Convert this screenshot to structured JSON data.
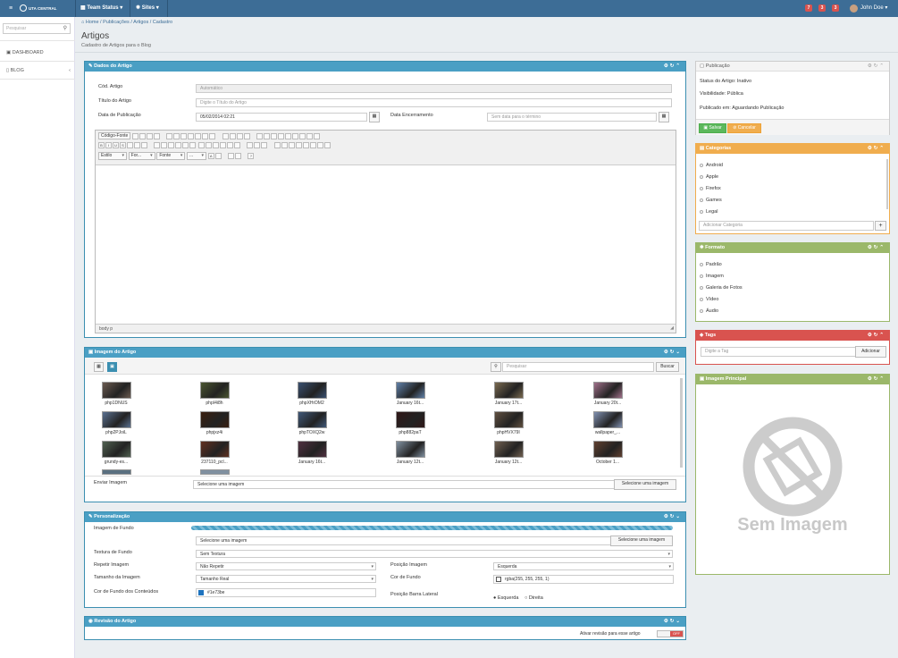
{
  "topbar": {
    "brand": "UTA CENTRAL",
    "menu1": "Team Status",
    "menu2": "Sites",
    "badges": [
      "7",
      "3",
      "3"
    ],
    "user": "John Doe"
  },
  "sidebar": {
    "search_placeholder": "Pesquisar",
    "items": [
      {
        "label": "DASHBOARD"
      },
      {
        "label": "BLOG"
      }
    ]
  },
  "breadcrumb": {
    "home": "Home",
    "b1": "Publicações",
    "b2": "Artigos",
    "b3": "Cadastro"
  },
  "page": {
    "title": "Artigos",
    "subtitle": "Cadastro de Artigos para o Blog"
  },
  "dados": {
    "title": "Dados do Artigo",
    "cod_label": "Cód. Artigo",
    "cod_value": "Automático",
    "titulo_label": "Título do Artigo",
    "titulo_placeholder": "Digite o Título do Artigo",
    "datapub_label": "Data de Publicação",
    "datapub_value": "05/02/2014 02:21",
    "dataenc_label": "Data Encerramento",
    "dataenc_placeholder": "Sem data para o término",
    "editor_source": "Código-Fonte",
    "editor_estilo": "Estilo",
    "editor_formatacao": "For...",
    "editor_fonte": "Fonte",
    "editor_tamanho": "...",
    "editor_status": "body p"
  },
  "imagem": {
    "title": "Imagem do Artigo",
    "search_placeholder": "Pesquisar",
    "search_btn": "Buscar",
    "enviar_label": "Enviar Imagem",
    "enviar_value": "Selecione uma imagem",
    "enviar_btn": "Selecione uma imagem",
    "thumbs": [
      {
        "caption": "php1DNUS",
        "color": "#6a5a50"
      },
      {
        "caption": "phpI4i8h",
        "color": "#4a5530"
      },
      {
        "caption": "phpXHrDM2",
        "color": "#3a5070"
      },
      {
        "caption": "January 16t...",
        "color": "#6080a8"
      },
      {
        "caption": "January 17t...",
        "color": "#7a6a50"
      },
      {
        "caption": "January 20t...",
        "color": "#a0708a"
      },
      {
        "caption": "php2PJoiL",
        "color": "#5a7090"
      },
      {
        "caption": "phpjxz4i",
        "color": "#3a2010"
      },
      {
        "caption": "phpTOXQ2w",
        "color": "#405878"
      },
      {
        "caption": "php882paT",
        "color": "#301818"
      },
      {
        "caption": "phpHVX79I",
        "color": "#605040"
      },
      {
        "caption": "wallpaper_...",
        "color": "#8090b0"
      },
      {
        "caption": "grundy-es...",
        "color": "#506050"
      },
      {
        "caption": "237110_pcl...",
        "color": "#603020"
      },
      {
        "caption": "January 16t...",
        "color": "#503040"
      },
      {
        "caption": "January 12t...",
        "color": "#8090a0"
      },
      {
        "caption": "January 12t...",
        "color": "#706050"
      },
      {
        "caption": "October 1...",
        "color": "#604030"
      }
    ]
  },
  "personalizacao": {
    "title": "Personalização",
    "imgfundo_label": "Imagem de Fundo",
    "imgfundo_value": "Selecione uma imagem",
    "imgfundo_btn": "Selecione uma imagem",
    "textura_label": "Textura de Fundo",
    "textura_value": "Sem Textura",
    "repetir_label": "Repetir Imagem",
    "repetir_value": "Não Repetir",
    "posicao_label": "Posição Imagem",
    "posicao_value": "Esquerda",
    "tamanho_label": "Tamanho da Imagem",
    "tamanho_value": "Tamanho Real",
    "cor_label": "Cor de Fundo",
    "cor_value": "rgba(255, 255, 255, 1)",
    "corcont_label": "Cor de Fundo dos Conteúdos",
    "corcont_value": "#1e73be",
    "posbarra_label": "Posição Barra Lateral",
    "posbarra_opt1": "Esquerda",
    "posbarra_opt2": "Direita"
  },
  "revisao": {
    "title": "Revisão do Artigo",
    "ativar_label": "Ativar revisão para esse artigo",
    "toggle_state": "OFF"
  },
  "publicacao": {
    "title": "Publicação",
    "status": "Status do Artigo: Inativo",
    "visibilidade": "Visibilidade: Pública",
    "publicado": "Publicado em: Aguardando Publicação",
    "salvar": "Salvar",
    "cancelar": "Cancelar"
  },
  "categorias": {
    "title": "Categorias",
    "items": [
      "Android",
      "Apple",
      "Firefox",
      "Games",
      "Legal"
    ],
    "add_placeholder": "Adicionar Categoria",
    "add_btn": "+"
  },
  "formato": {
    "title": "Formato",
    "items": [
      "Padrão",
      "Imagem",
      "Galeria de Fotos",
      "Vídeo",
      "Áudio"
    ]
  },
  "tags": {
    "title": "Tags",
    "placeholder": "Digite a Tag",
    "add_btn": "Adicionar"
  },
  "imagem_principal": {
    "title": "Imagem Principal",
    "no_image_text": "Sem Imagem"
  },
  "colors": {
    "topbar": "#3d6d96",
    "panel_blue": "#4a9fc4",
    "orange": "#f0ad4e",
    "green": "#9bb86a",
    "red": "#d9534f",
    "btn_green": "#5cb85c"
  }
}
